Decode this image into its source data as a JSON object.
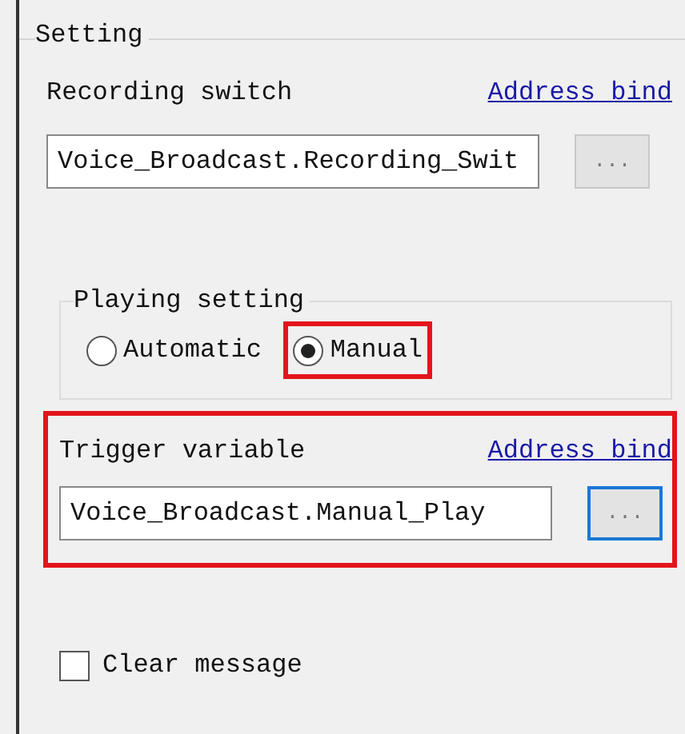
{
  "group_title": "Setting",
  "recording": {
    "label": "Recording switch",
    "link": "Address bind",
    "value": "Voice_Broadcast.Recording_Swit",
    "button": "...",
    "focused": false,
    "highlighted": false
  },
  "playing": {
    "title": "Playing setting",
    "options": [
      {
        "label": "Automatic",
        "selected": false,
        "highlighted": false
      },
      {
        "label": "Manual",
        "selected": true,
        "highlighted": true
      }
    ]
  },
  "trigger": {
    "label": "Trigger variable",
    "link": "Address bind",
    "value": "Voice_Broadcast.Manual_Play",
    "button": "...",
    "focused": true,
    "highlighted": true
  },
  "clear_message": {
    "label": "Clear message",
    "checked": false
  }
}
